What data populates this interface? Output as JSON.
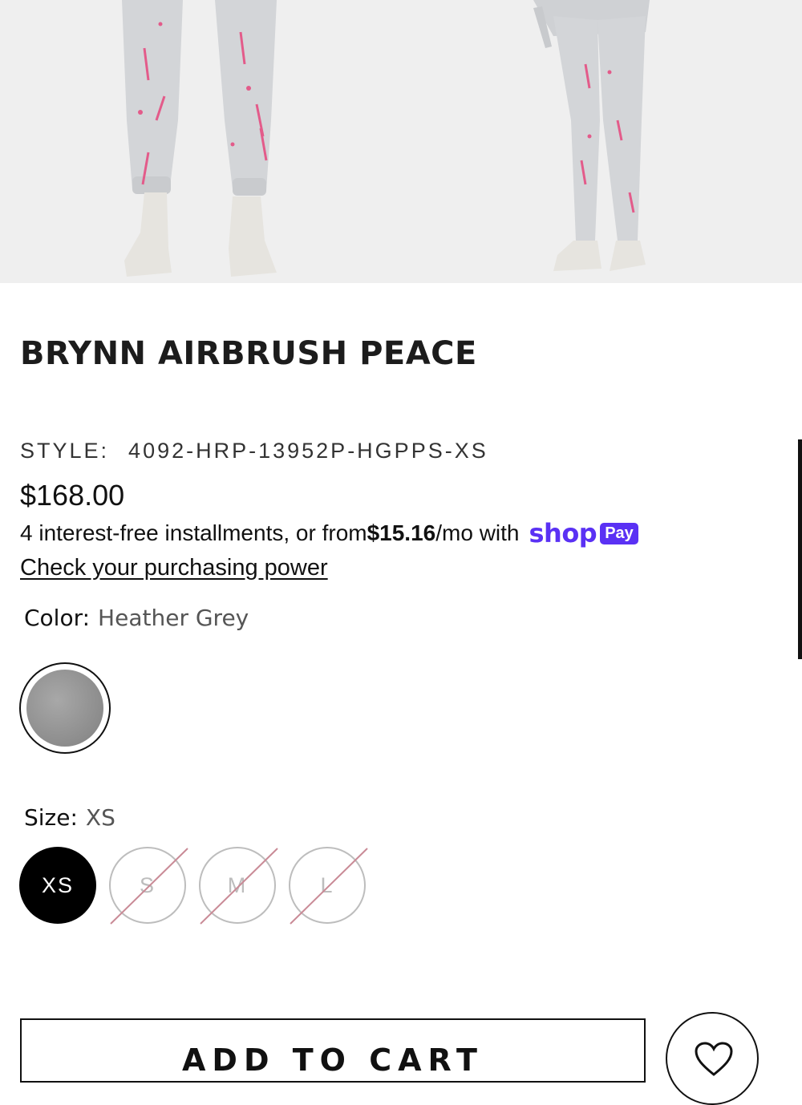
{
  "product": {
    "title": "BRYNN AIRBRUSH PEACE",
    "style_label": "STYLE:",
    "style_value": "4092-HRP-13952P-HGPPS-XS",
    "price": "$168.00"
  },
  "installments": {
    "text_before": "4 interest-free installments, or from ",
    "amount": "$15.16",
    "text_after": "/mo with",
    "provider_logo": "shop",
    "provider_badge": "Pay",
    "check_link": "Check your purchasing power"
  },
  "color": {
    "label": "Color:",
    "value": "Heather Grey",
    "swatch_color": "#9a9a9a"
  },
  "size": {
    "label": "Size:",
    "value": "XS",
    "options": [
      {
        "label": "XS",
        "selected": true,
        "available": true
      },
      {
        "label": "S",
        "selected": false,
        "available": false
      },
      {
        "label": "M",
        "selected": false,
        "available": false
      },
      {
        "label": "L",
        "selected": false,
        "available": false
      }
    ]
  },
  "actions": {
    "add_to_cart": "ADD TO CART",
    "wishlist_icon": "heart-icon"
  },
  "colors": {
    "accent_shop": "#5a31f4",
    "unavailable": "#bdbdbd",
    "strike": "#c98a96"
  }
}
